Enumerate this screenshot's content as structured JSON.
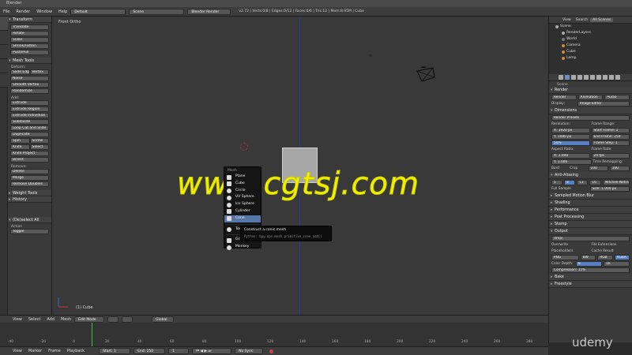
{
  "titlebar": {
    "text": "Blender"
  },
  "header": {
    "menus": [
      "File",
      "Render",
      "Window",
      "Help"
    ],
    "layout": "Default",
    "scene": "Scene",
    "engine": "Blender Render",
    "stats": "v2.72 | Verts:0/8 | Edges:0/12 | Faces:0/6 | Tris:12 | Mem:8.95M | Cube"
  },
  "toolshelf": {
    "transform": {
      "title": "Transform",
      "buttons": [
        "Translate",
        "Rotate",
        "Scale",
        "Shrink/Fatten",
        "Push/Pull"
      ]
    },
    "mesh_tools": {
      "title": "Mesh Tools",
      "deform_label": "Deform:",
      "slide_edge": "Slide Edg",
      "vertex": "Vertex",
      "noise": "Noise",
      "smooth_vertex": "Smooth Vertex",
      "randomize": "Randomize",
      "add_label": "Add:",
      "extrude": "Extrude",
      "extrude_region": "Extrude Region",
      "extrude_individual": "Extrude Individual",
      "subdivide": "Subdivide",
      "loop_cut": "Loop Cut and Slide",
      "duplicate": "Duplicate",
      "spin": "Spin",
      "screw": "Screw",
      "knife": "Knife",
      "select": "Select",
      "knife_project": "Knife Project",
      "bisect": "Bisect",
      "remove_label": "Remove:",
      "delete": "Delete",
      "merge": "Merge",
      "remove_doubles": "Remove Doubles"
    },
    "weight_tools": "Weight Tools",
    "history": "History",
    "operator": {
      "title": "(De)select All",
      "action_label": "Action",
      "action_value": "Toggle"
    }
  },
  "viewport": {
    "title": "Front Ortho",
    "footer": "(1) Cube",
    "watermark": "www.cgtsj.com"
  },
  "addmenu": {
    "title": "Mesh",
    "items": [
      "Plane",
      "Cube",
      "Circle",
      "UV Sphere",
      "Ico Sphere",
      "Cylinder",
      "Cone",
      "Torus",
      "Grid",
      "Monkey"
    ],
    "highlighted_index": 6
  },
  "tooltip": {
    "title": "Construct a conic mesh",
    "python": "Python: bpy.ops.mesh.primitive_cone_add()"
  },
  "outliner": {
    "tabs": [
      "View",
      "Search",
      "All Scenes"
    ],
    "rows": [
      "Scene",
      "RenderLayers",
      "World",
      "Camera",
      "Cube",
      "Lamp"
    ]
  },
  "properties": {
    "breadcrumb": "Scene",
    "render": "Render",
    "buttons": [
      "Render",
      "Animation",
      "Audio"
    ],
    "display_label": "Display:",
    "display_value": "Image Editor",
    "dimensions": "Dimensions",
    "presets": "Render Presets",
    "resolution": "Resolution:",
    "frame_range": "Frame Range:",
    "res_x": "X: 1920 px",
    "start_frame": "Start Frame: 1",
    "res_y": "Y: 1080 px",
    "end_frame": "End Frame: 250",
    "res_pct": "50%",
    "frame_step": "Frame Step: 1",
    "aspect": "Aspect Ratio:",
    "frame_rate": "Frame Rate:",
    "asp_x": "X: 1.000",
    "fps": "24 fps",
    "asp_y": "Y: 1.000",
    "time_remap": "Time Remapping:",
    "border": "Bord",
    "crop": "Crop",
    "old": "100",
    "new": "100",
    "anti_aliasing": "Anti-Aliasing",
    "aa_samples": [
      "5",
      "8",
      "11",
      "16"
    ],
    "aa_filter": "Mitchell-Netravali",
    "full_sample": "Full Sample",
    "aa_size": "Size: 1.000 px",
    "sampled_motion_blur": "Sampled Motion Blur",
    "shading": "Shading",
    "performance": "Performance",
    "post_processing": "Post Processing",
    "stamp": "Stamp",
    "output": "Output",
    "output_path": "/tmp\\",
    "overwrite": "Overwrite",
    "file_extensions": "File Extensions",
    "placeholders": "Placeholders",
    "cache_result": "Cache Result",
    "format": "PNG",
    "color_modes": [
      "BW",
      "RGB",
      "RGBA"
    ],
    "color_depth_label": "Color Depth:",
    "color_depths": [
      "8",
      "16"
    ],
    "compression": "Compression: 15%",
    "bake": "Bake",
    "freestyle": "Freestyle"
  },
  "timeline_header": {
    "items": [
      "View",
      "Select",
      "Add",
      "Mesh"
    ],
    "mode": "Edit Mode",
    "pivot": "Global"
  },
  "timeline": {
    "ticks": [
      "-40",
      "-20",
      "0",
      "20",
      "40",
      "60",
      "80",
      "100",
      "120",
      "140",
      "160",
      "180",
      "200",
      "220",
      "240",
      "260",
      "280"
    ],
    "footer_items": [
      "View",
      "Marker",
      "Frame",
      "Playback"
    ],
    "start": "Start: 1",
    "end": "End: 250",
    "current": "1",
    "sync": "No Sync"
  },
  "brand": "udemy"
}
